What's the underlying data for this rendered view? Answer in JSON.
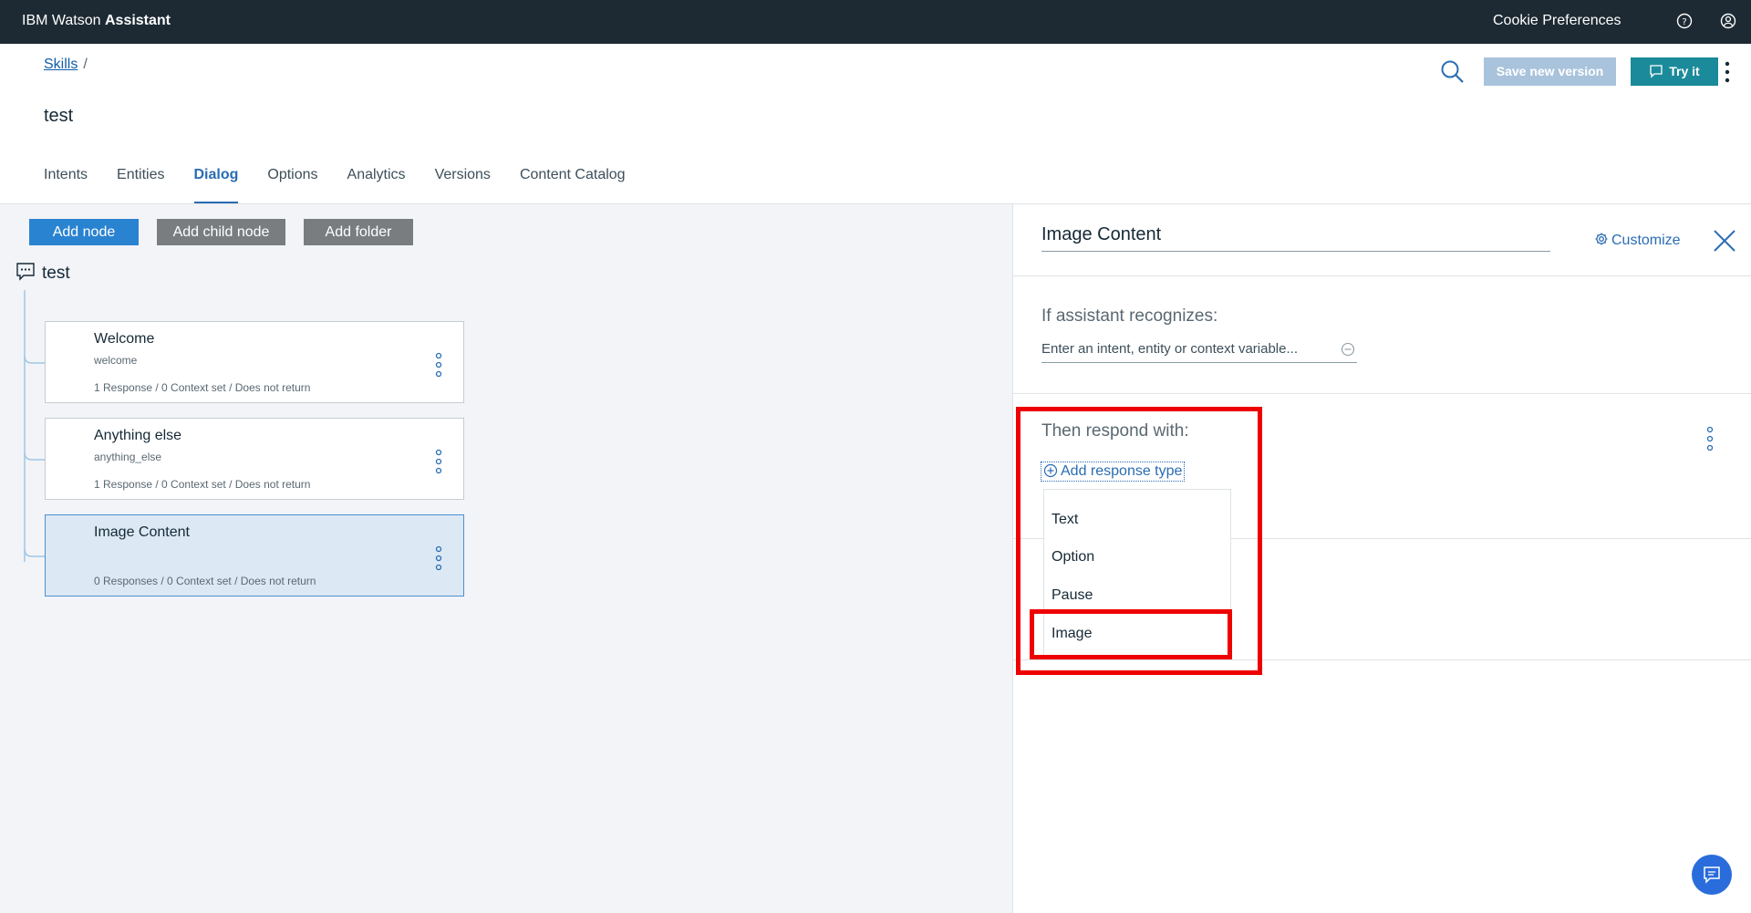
{
  "topbar": {
    "brand_light": "IBM Watson ",
    "brand_bold": "Assistant",
    "cookie_label": "Cookie Preferences",
    "help_icon": "help-icon",
    "user_icon": "user-icon",
    "background": "#1d2a33"
  },
  "header": {
    "breadcrumb_link": "Skills",
    "breadcrumb_sep": "/",
    "skill_name": "test",
    "save_label": "Save new version",
    "try_label": "Try it"
  },
  "tabs": [
    {
      "label": "Intents",
      "active": false
    },
    {
      "label": "Entities",
      "active": false
    },
    {
      "label": "Dialog",
      "active": true
    },
    {
      "label": "Options",
      "active": false
    },
    {
      "label": "Analytics",
      "active": false
    },
    {
      "label": "Versions",
      "active": false
    },
    {
      "label": "Content Catalog",
      "active": false
    }
  ],
  "toolbar": {
    "add_node": "Add node",
    "add_child_node": "Add child node",
    "add_folder": "Add folder"
  },
  "tree": {
    "root_label": "test",
    "nodes": [
      {
        "title": "Welcome",
        "id": "welcome",
        "meta": "1 Response / 0 Context set / Does not return",
        "selected": false
      },
      {
        "title": "Anything else",
        "id": "anything_else",
        "meta": "1 Response / 0 Context set / Does not return",
        "selected": false
      },
      {
        "title": "Image Content",
        "id": "",
        "meta": "0 Responses / 0 Context set / Does not return",
        "selected": true
      }
    ]
  },
  "panel": {
    "node_name": "Image Content",
    "customize_label": "Customize",
    "condition_label": "If assistant recognizes:",
    "condition_placeholder": "Enter an intent, entity or context variable...",
    "respond_label": "Then respond with:",
    "add_response_label": "Add response type",
    "response_types": [
      "Text",
      "Option",
      "Pause",
      "Image"
    ],
    "highlighted_option": "Image"
  },
  "colors": {
    "accent": "#2a6cb3",
    "highlight": "#ee0000",
    "selected_node": "#dce9f4"
  }
}
